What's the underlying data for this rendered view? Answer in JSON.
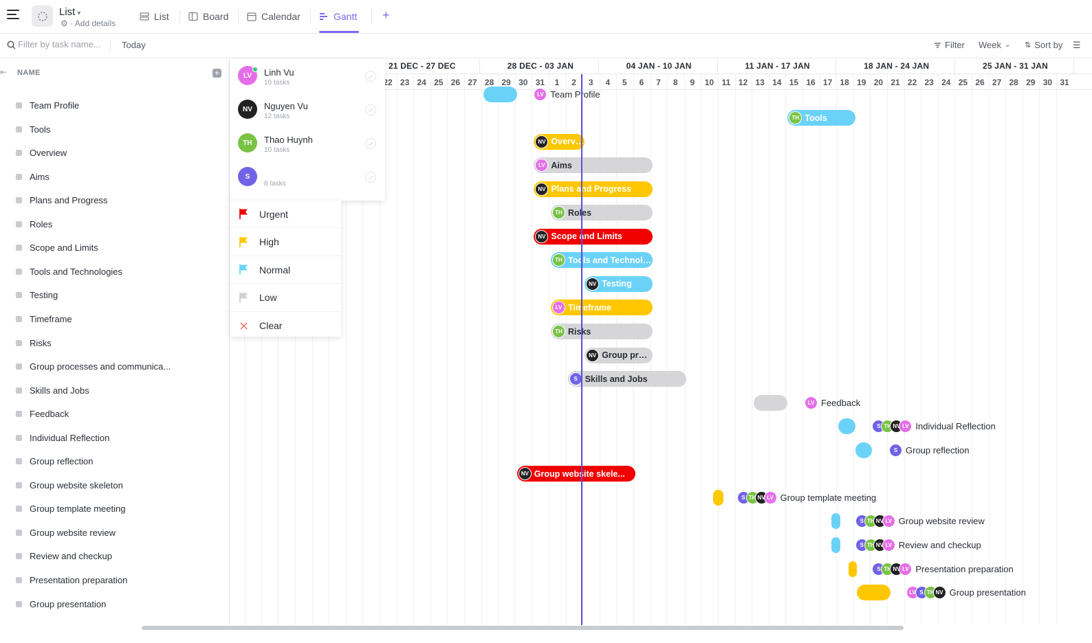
{
  "header": {
    "list_title": "List",
    "add_details": "Add details",
    "tabs": [
      {
        "label": "List",
        "icon": "list-icon"
      },
      {
        "label": "Board",
        "icon": "board-icon"
      },
      {
        "label": "Calendar",
        "icon": "calendar-icon"
      },
      {
        "label": "Gantt",
        "icon": "gantt-icon",
        "active": true
      }
    ],
    "add_view": "+"
  },
  "toolbar": {
    "filter_placeholder": "Filter by task name...",
    "today": "Today",
    "filter": "Filter",
    "week": "Week",
    "sort_by": "Sort by"
  },
  "left_panel": {
    "name_header": "NAME",
    "tasks": [
      "Team Profile",
      "Tools",
      "Overview",
      "Aims",
      "Plans and Progress",
      "Roles",
      "Scope and Limits",
      "Tools and Technologies",
      "Testing",
      "Timeframe",
      "Risks",
      "Group processes and communica...",
      "Skills and Jobs",
      "Feedback",
      "Individual Reflection",
      "Group reflection",
      "Group website skeleton",
      "Group template meeting",
      "Group website review",
      "Review and checkup",
      "Presentation preparation",
      "Group presentation"
    ]
  },
  "gantt": {
    "weeks": [
      "21 DEC - 27 DEC",
      "28 DEC - 03 JAN",
      "04 JAN - 10 JAN",
      "11 JAN - 17 JAN",
      "18 JAN - 24 JAN",
      "25 JAN - 31 JAN"
    ],
    "days": [
      "22",
      "23",
      "24",
      "25",
      "26",
      "27",
      "28",
      "29",
      "30",
      "31",
      "1",
      "2",
      "3",
      "4",
      "5",
      "6",
      "7",
      "8",
      "9",
      "10",
      "11",
      "12",
      "13",
      "14",
      "15",
      "16",
      "17",
      "18",
      "19",
      "20",
      "21",
      "22",
      "23",
      "24",
      "25",
      "26",
      "27",
      "28",
      "29",
      "30",
      "31"
    ],
    "bars": [
      {
        "color": "blue",
        "start": 7,
        "end": 9
      },
      {
        "label": "Tools",
        "color": "blue",
        "start": 25,
        "end": 29,
        "avatars": [
          "TH"
        ]
      },
      {
        "label": "Overview",
        "color": "yellow",
        "start": 10,
        "end": 13,
        "avatars": [
          "NV"
        ]
      },
      {
        "label": "Aims",
        "color": "gray",
        "start": 10,
        "end": 17,
        "avatars": [
          "LV"
        ]
      },
      {
        "label": "Plans and Progress",
        "color": "yellow",
        "start": 10,
        "end": 17,
        "avatars": [
          "NV"
        ]
      },
      {
        "label": "Roles",
        "color": "gray",
        "start": 11,
        "end": 17,
        "avatars": [
          "TH"
        ]
      },
      {
        "label": "Scope and Limits",
        "color": "red",
        "start": 10,
        "end": 17,
        "avatars": [
          "NV"
        ]
      },
      {
        "label": "Tools and Technolog...",
        "color": "blue",
        "start": 11,
        "end": 17,
        "avatars": [
          "TH"
        ]
      },
      {
        "label": "Testing",
        "color": "blue",
        "start": 13,
        "end": 17,
        "avatars": [
          "NV"
        ]
      },
      {
        "label": "Timeframe",
        "color": "yellow",
        "start": 11,
        "end": 17,
        "avatars": [
          "LV"
        ]
      },
      {
        "label": "Risks",
        "color": "gray",
        "start": 11,
        "end": 17,
        "avatars": [
          "TH"
        ]
      },
      {
        "label": "Group proce...",
        "color": "gray",
        "start": 13,
        "end": 17,
        "avatars": [
          "NV"
        ]
      },
      {
        "label": "Skills and Jobs",
        "color": "gray",
        "start": 12,
        "end": 19,
        "avatars": [
          "S"
        ]
      },
      {
        "color": "gray",
        "start": 23,
        "end": 25
      },
      {
        "color": "blue",
        "start": 28,
        "end": 29
      },
      {
        "color": "blue",
        "start": 29,
        "end": 30
      },
      {
        "label": "Group website skele...",
        "color": "red",
        "start": 9,
        "end": 16,
        "avatars": [
          "NV"
        ]
      },
      {
        "color": "yellow",
        "start": 20.6,
        "end": 21.2
      },
      {
        "color": "blue",
        "start": 27.6,
        "end": 28.1
      },
      {
        "color": "blue",
        "start": 27.6,
        "end": 28.1
      },
      {
        "color": "yellow",
        "start": 28.6,
        "end": 29.1
      },
      {
        "color": "yellow",
        "start": 29.1,
        "end": 31.1
      }
    ],
    "ext_labels": [
      {
        "row": 0,
        "start": 10,
        "label": "Team Profile",
        "avatars": [
          "LV"
        ]
      },
      {
        "row": 13,
        "start": 26,
        "label": "Feedback",
        "avatars": [
          "LV"
        ]
      },
      {
        "row": 14,
        "start": 30,
        "label": "Individual Reflection",
        "avatars": [
          "S",
          "TH",
          "NV",
          "LV"
        ]
      },
      {
        "row": 15,
        "start": 31,
        "label": "Group reflection",
        "avatars": [
          "S"
        ]
      },
      {
        "row": 17,
        "start": 22,
        "label": "Group template meeting",
        "avatars": [
          "S",
          "TH",
          "NV",
          "LV"
        ]
      },
      {
        "row": 18,
        "start": 29,
        "label": "Group website review",
        "avatars": [
          "S",
          "TH",
          "NV",
          "LV"
        ]
      },
      {
        "row": 19,
        "start": 29,
        "label": "Review and checkup",
        "avatars": [
          "S",
          "TH",
          "NV",
          "LV"
        ]
      },
      {
        "row": 20,
        "start": 30,
        "label": "Presentation preparation",
        "avatars": [
          "S",
          "TH",
          "NV",
          "LV"
        ]
      },
      {
        "row": 21,
        "start": 32,
        "label": "Group presentation",
        "avatars": [
          "LV",
          "S",
          "TH",
          "NV"
        ]
      }
    ]
  },
  "assignees": [
    {
      "initials": "LV",
      "name": "Linh Vu",
      "count": "10 tasks",
      "color": "#e56ee8",
      "online": true
    },
    {
      "initials": "NV",
      "name": "Nguyen Vu",
      "count": "12 tasks",
      "color": "#222222"
    },
    {
      "initials": "TH",
      "name": "Thao Huynh",
      "count": "10 tasks",
      "color": "#79c344"
    },
    {
      "initials": "S",
      "name": "",
      "count": "8 tasks",
      "color": "#7163e6"
    }
  ],
  "priorities": [
    {
      "label": "Urgent",
      "color": "#f00000",
      "icon": "flag-icon"
    },
    {
      "label": "High",
      "color": "#ffc700",
      "icon": "flag-icon"
    },
    {
      "label": "Normal",
      "color": "#6bd2f7",
      "icon": "flag-icon"
    },
    {
      "label": "Low",
      "color": "#d0d0d4",
      "icon": "flag-icon"
    },
    {
      "label": "Clear",
      "color": "#f06a5e",
      "icon": "close-icon"
    }
  ]
}
